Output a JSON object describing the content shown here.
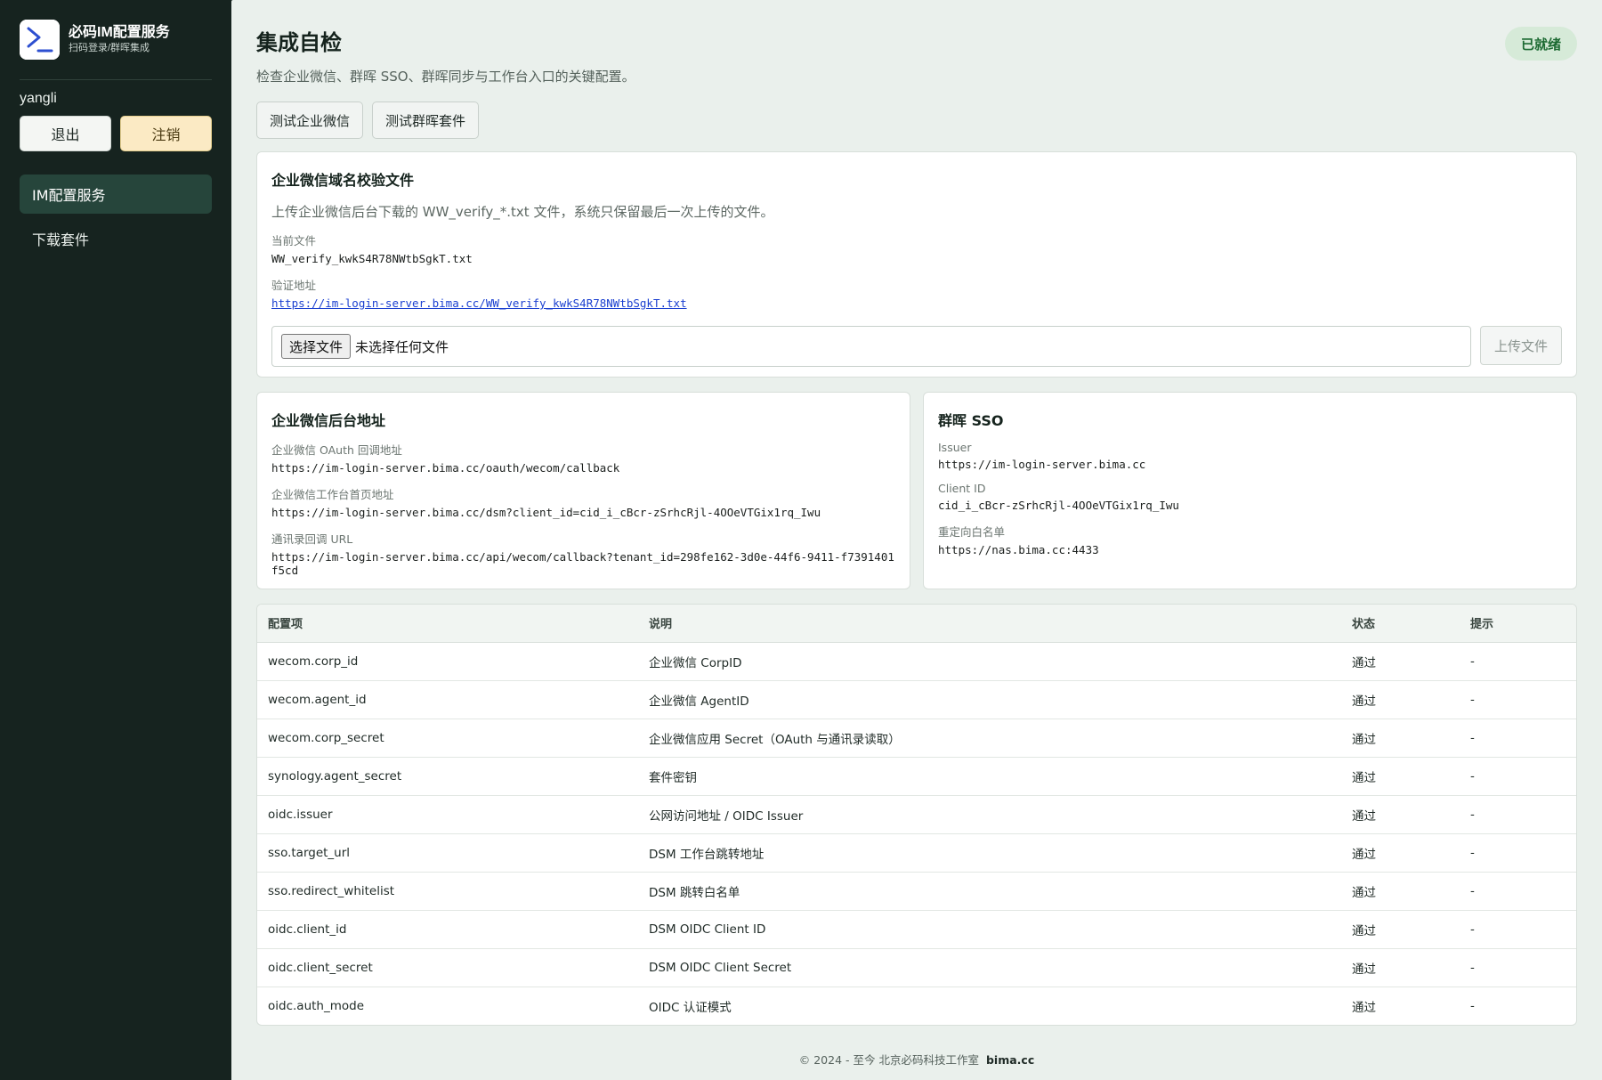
{
  "brand": {
    "title": "必码IM配置服务",
    "subtitle": "扫码登录/群晖集成",
    "logo_icon": "terminal-prompt-icon"
  },
  "user": {
    "name": "yangli",
    "logout_label": "退出",
    "cancel_label": "注销"
  },
  "nav": {
    "items": [
      {
        "label": "IM配置服务",
        "active": true
      },
      {
        "label": "下载套件",
        "active": false
      }
    ]
  },
  "header": {
    "title": "集成自检",
    "subtitle": "检查企业微信、群晖 SSO、群晖同步与工作台入口的关键配置。",
    "badge": "已就绪"
  },
  "tests": {
    "wecom_label": "测试企业微信",
    "synology_label": "测试群晖套件"
  },
  "verify": {
    "title": "企业微信域名校验文件",
    "desc": "上传企业微信后台下载的 WW_verify_*.txt 文件，系统只保留最后一次上传的文件。",
    "current_label": "当前文件",
    "current_value": "WW_verify_kwkS4R78NWtbSgkT.txt",
    "url_label": "验证地址",
    "url_value": "https://im-login-server.bima.cc/WW_verify_kwkS4R78NWtbSgkT.txt",
    "choose_label": "选择文件",
    "no_file_label": "未选择任何文件",
    "upload_label": "上传文件"
  },
  "wecom": {
    "title": "企业微信后台地址",
    "oauth_label": "企业微信 OAuth 回调地址",
    "oauth_value": "https://im-login-server.bima.cc/oauth/wecom/callback",
    "home_label": "企业微信工作台首页地址",
    "home_value": "https://im-login-server.bima.cc/dsm?client_id=cid_i_cBcr-zSrhcRjl-4OOeVTGix1rq_Iwu",
    "contacts_label": "通讯录回调 URL",
    "contacts_value": "https://im-login-server.bima.cc/api/wecom/callback?tenant_id=298fe162-3d0e-44f6-9411-f7391401f5cd"
  },
  "sso": {
    "title": "群晖 SSO",
    "issuer_label": "Issuer",
    "issuer_value": "https://im-login-server.bima.cc",
    "client_label": "Client ID",
    "client_value": "cid_i_cBcr-zSrhcRjl-4OOeVTGix1rq_Iwu",
    "redirect_label": "重定向白名单",
    "redirect_value": "https://nas.bima.cc:4433"
  },
  "table": {
    "headers": [
      "配置项",
      "说明",
      "状态",
      "提示"
    ],
    "rows": [
      [
        "wecom.corp_id",
        "企业微信 CorpID",
        "通过",
        "-"
      ],
      [
        "wecom.agent_id",
        "企业微信 AgentID",
        "通过",
        "-"
      ],
      [
        "wecom.corp_secret",
        "企业微信应用 Secret（OAuth 与通讯录读取）",
        "通过",
        "-"
      ],
      [
        "synology.agent_secret",
        "套件密钥",
        "通过",
        "-"
      ],
      [
        "oidc.issuer",
        "公网访问地址 / OIDC Issuer",
        "通过",
        "-"
      ],
      [
        "sso.target_url",
        "DSM 工作台跳转地址",
        "通过",
        "-"
      ],
      [
        "sso.redirect_whitelist",
        "DSM 跳转白名单",
        "通过",
        "-"
      ],
      [
        "oidc.client_id",
        "DSM OIDC Client ID",
        "通过",
        "-"
      ],
      [
        "oidc.client_secret",
        "DSM OIDC Client Secret",
        "通过",
        "-"
      ],
      [
        "oidc.auth_mode",
        "OIDC 认证模式",
        "通过",
        "-"
      ]
    ]
  },
  "footer": {
    "text": "© 2024 - 至今 北京必码科技工作室",
    "link": "bima.cc"
  }
}
